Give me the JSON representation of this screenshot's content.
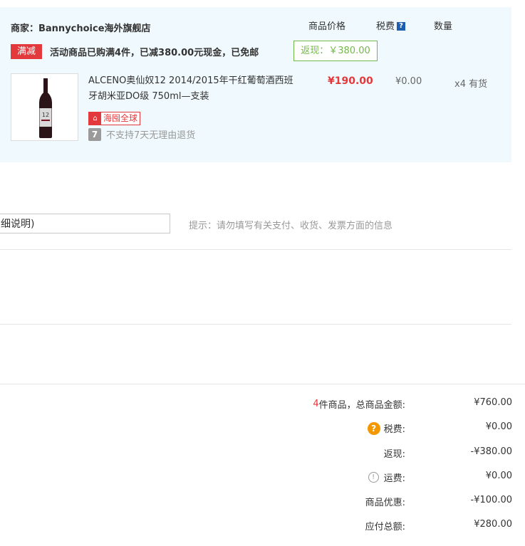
{
  "store": {
    "merchant_label": "商家：Bannychoice海外旗舰店",
    "columns": {
      "price": "商品价格",
      "tax": "税费",
      "tax_help": "?",
      "qty": "数量"
    },
    "promo": {
      "tag": "满减",
      "text": "活动商品已购满4件，已减380.00元现金，已免邮",
      "rebate": "返现：￥380.00"
    },
    "item": {
      "name": "ALCENO奥仙奴12 2014/2015年干红葡萄酒西班牙胡米亚DO级 750ml—支装",
      "bottle_label": "12",
      "badge_icon": "shop-icon",
      "badge": "海囤全球",
      "seven_icon": "7",
      "return_policy": "不支持7天无理由退货",
      "price": "¥190.00",
      "tax": "¥0.00",
      "qty": "x4 有货"
    }
  },
  "remark": {
    "value": "细说明)",
    "hint": "提示：请勿填写有关支付、收货、发票方面的信息"
  },
  "summary": {
    "count": "4",
    "count_suffix": " 件商品，总商品金额:",
    "total_goods": "¥760.00",
    "tax_label": "税费:",
    "tax_icon": "?",
    "tax_value": "¥0.00",
    "rebate_label": "返现:",
    "rebate_value": "-¥380.00",
    "shipping_icon": "!",
    "shipping_label": "运费:",
    "shipping_value": "¥0.00",
    "discount_label": "商品优惠:",
    "discount_value": "-¥100.00",
    "payable_label": "应付总额:",
    "payable_value": "¥280.00"
  },
  "colors": {
    "accent_red": "#e4393c",
    "rebate_green": "#74b84a",
    "panel_bg": "#f0f9fd",
    "help_orange": "#f39800"
  }
}
